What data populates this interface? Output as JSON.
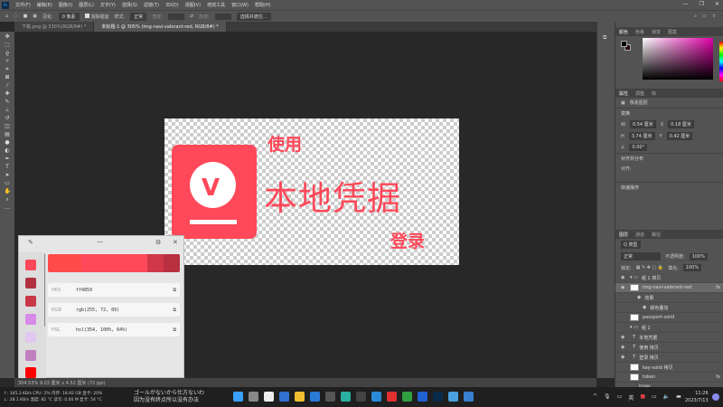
{
  "menu": {
    "logo": "Ps",
    "items": [
      "文件(F)",
      "编辑(E)",
      "图像(I)",
      "图层(L)",
      "文字(Y)",
      "选择(S)",
      "滤镜(T)",
      "3D(D)",
      "视图(V)",
      "增效工具",
      "窗口(W)",
      "帮助(H)"
    ]
  },
  "options": {
    "feather_label": "羽化:",
    "feather_value": "0 像素",
    "antialias": "消除锯齿",
    "style_label": "样式:",
    "style_value": "正常",
    "width_label": "宽度:",
    "height_label": "高度:",
    "select_mask": "选择并遮住..."
  },
  "tabs": [
    {
      "label": "下载.png @ 330%(RGB/8#) *"
    },
    {
      "label": "未标题-1 @ 305% (img-navi-valorant-red, RGB/8#) *"
    }
  ],
  "canvas": {
    "line1": "使用",
    "line2": "本地凭据",
    "line3": "登录",
    "color": "#ff4859"
  },
  "color_panel": {
    "tabs": [
      "颜色",
      "色板",
      "渐变",
      "图案"
    ]
  },
  "properties": {
    "tabs": [
      "属性",
      "调整",
      "库"
    ],
    "doc_label": "像素图层",
    "transform": "变换",
    "w_label": "W",
    "w": "0.54 厘米",
    "x_label": "X",
    "x": "0.18 厘米",
    "h_label": "H",
    "h": "3.74 厘米",
    "y_label": "Y",
    "y": "0.42 厘米",
    "angle": "0.00°",
    "align": "对齐并分布",
    "align_label": "对齐:",
    "quick": "快速操作"
  },
  "layers": {
    "tabs": [
      "图层",
      "通道",
      "路径"
    ],
    "kind": "Q 类型",
    "blend": "正常",
    "opacity_label": "不透明度:",
    "opacity": "100%",
    "lock_label": "锁定:",
    "fill_label": "填充:",
    "fill": "100%",
    "items": [
      {
        "name": "组 1 拷贝",
        "type": "group"
      },
      {
        "name": "img-navi-valorant-red",
        "type": "layer",
        "fx": "fx"
      },
      {
        "name": "效果",
        "type": "effect"
      },
      {
        "name": "颜色叠加",
        "type": "effect"
      },
      {
        "name": "passport-solid",
        "type": "layer"
      },
      {
        "name": "组 1",
        "type": "group"
      },
      {
        "name": "本地凭据",
        "type": "text"
      },
      {
        "name": "使用 拷贝",
        "type": "text"
      },
      {
        "name": "登录 拷贝",
        "type": "text"
      },
      {
        "name": "key-solid 拷贝",
        "type": "layer"
      },
      {
        "name": "token",
        "type": "layer",
        "fx": "fx"
      },
      {
        "name": "Image",
        "type": "sub"
      }
    ]
  },
  "picker": {
    "hex_label": "HEX",
    "hex": "ff4859",
    "rgb_label": "RGB",
    "rgb": "rgb(255, 72, 89)",
    "hsl_label": "HSL",
    "hsl": "hsl(354, 100%, 64%)",
    "swatches": [
      "#ff4859",
      "#b03040",
      "#c83848",
      "#d88ae8",
      "#e0c8f0",
      "#c080c0",
      "#ff0000"
    ],
    "preview": [
      "#ff4a4a",
      "#ff4859",
      "#ff4859",
      "#d03848",
      "#b83040"
    ]
  },
  "status": {
    "text": "304.53%   9.03 厘米 x 4.52 厘米 (72 ppi)"
  },
  "taskbar": {
    "net_up": "↑: 345.3 KB/s CPU: 2% 内存: 18.92 GB 显卡: 20%",
    "net_down": "↓: 28.1 KB/s 温度: 82 °C 读写: 0.00 M 显卡: 54 °C",
    "lyric1": "ゴールがないから仕方ないわ",
    "lyric2": "因为没有终点所以没有办法",
    "time": "11:26",
    "date": "2023/7/13",
    "ime": "英"
  }
}
